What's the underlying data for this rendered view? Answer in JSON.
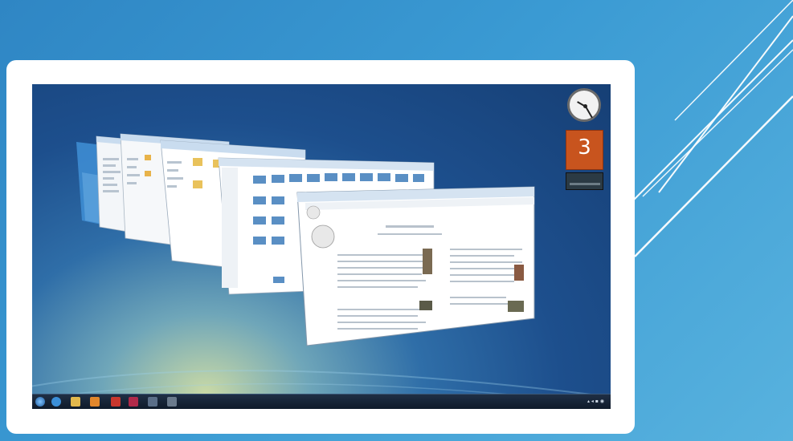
{
  "slide": {
    "background_accent": "#3a9ad3",
    "card_color": "#ffffff"
  },
  "desktop": {
    "gadgets": {
      "clock": {
        "icon": "clock-icon"
      },
      "calendar": {
        "day": "3",
        "color": "#c8541e"
      }
    },
    "windows": [
      {
        "name": "window-1",
        "kind": "explorer"
      },
      {
        "name": "window-2",
        "kind": "explorer"
      },
      {
        "name": "window-3",
        "kind": "explorer"
      },
      {
        "name": "window-4",
        "kind": "photo-gallery"
      },
      {
        "name": "window-5",
        "kind": "browser-wikipedia"
      }
    ],
    "taskbar": {
      "icons": [
        "start-orb-icon",
        "ie-icon",
        "folder-icon",
        "media-icon",
        "paint-icon",
        "app-icon-1",
        "app-icon-2",
        "app-icon-3"
      ]
    }
  }
}
